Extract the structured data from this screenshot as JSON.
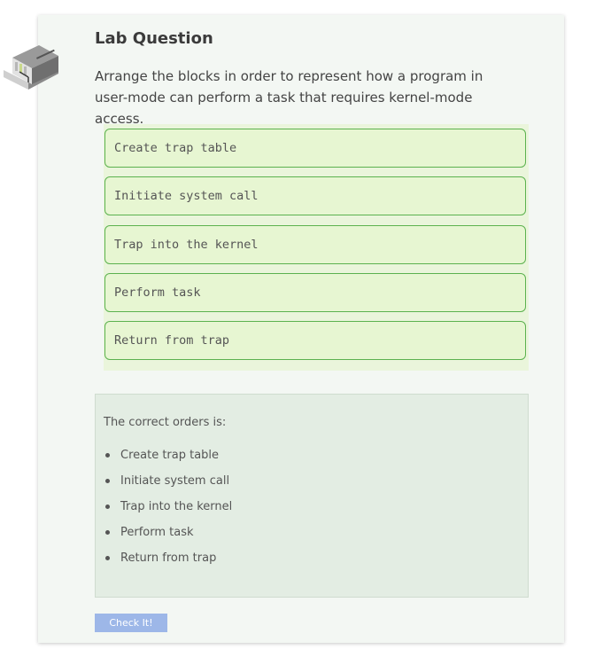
{
  "lab": {
    "title": "Lab Question",
    "prompt": "Arrange the blocks in order to represent how a program in user-mode can perform a task that requires kernel-mode access."
  },
  "blocks": [
    "Create trap table",
    "Initiate system call",
    "Trap into the kernel",
    "Perform task",
    "Return from trap"
  ],
  "answer": {
    "intro": "The correct orders is:",
    "items": [
      "Create trap table",
      "Initiate system call",
      "Trap into the kernel",
      "Perform task",
      "Return from trap"
    ]
  },
  "check_button": "Check It!",
  "icon": "lab-building-icon",
  "colors": {
    "card_bg": "#f3f7f3",
    "block_bg": "#e7f6d2",
    "block_border": "#5cb24f",
    "answer_bg": "#e3ede3",
    "button_bg": "#9db7e8"
  }
}
